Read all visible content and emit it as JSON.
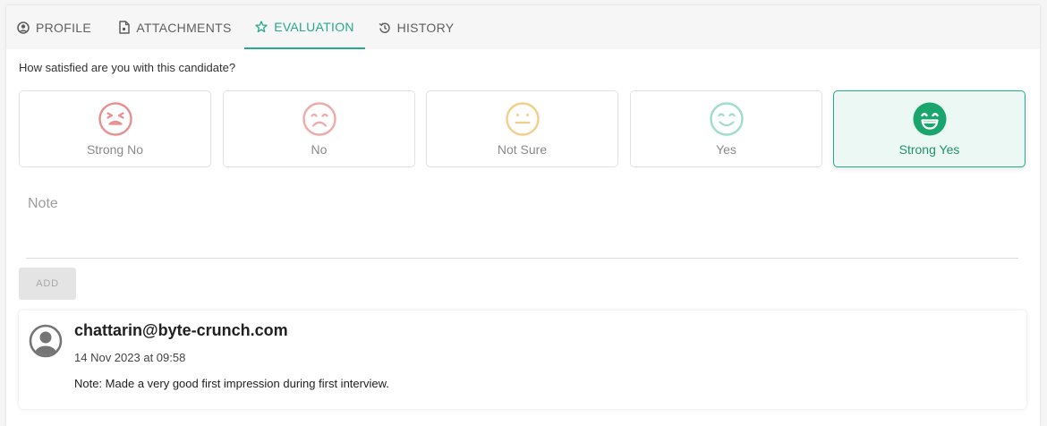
{
  "tabs": [
    {
      "label": "PROFILE",
      "icon": "user-circle-icon"
    },
    {
      "label": "ATTACHMENTS",
      "icon": "document-icon"
    },
    {
      "label": "EVALUATION",
      "icon": "star-icon",
      "active": true
    },
    {
      "label": "HISTORY",
      "icon": "history-icon"
    }
  ],
  "colors": {
    "accent": "#26a98c",
    "strong_no": "#e88f8f",
    "no": "#f0a9a9",
    "not_sure": "#f2cf8a",
    "yes": "#9edccd",
    "strong_yes": "#1aa56d"
  },
  "evaluation": {
    "question": "How satisfied are you with this candidate?",
    "ratings": [
      {
        "label": "Strong No",
        "icon": "furious-face-icon"
      },
      {
        "label": "No",
        "icon": "sad-face-icon"
      },
      {
        "label": "Not Sure",
        "icon": "neutral-face-icon"
      },
      {
        "label": "Yes",
        "icon": "smile-face-icon"
      },
      {
        "label": "Strong Yes",
        "icon": "grin-face-icon",
        "selected": true
      }
    ],
    "selected": "Strong Yes",
    "note_placeholder": "Note",
    "note_value": "",
    "add_label": "ADD"
  },
  "comments": [
    {
      "author": "chattarin@byte-crunch.com",
      "date": "14 Nov 2023 at 09:58",
      "text": "Note: Made a very good first impression during first interview."
    }
  ]
}
